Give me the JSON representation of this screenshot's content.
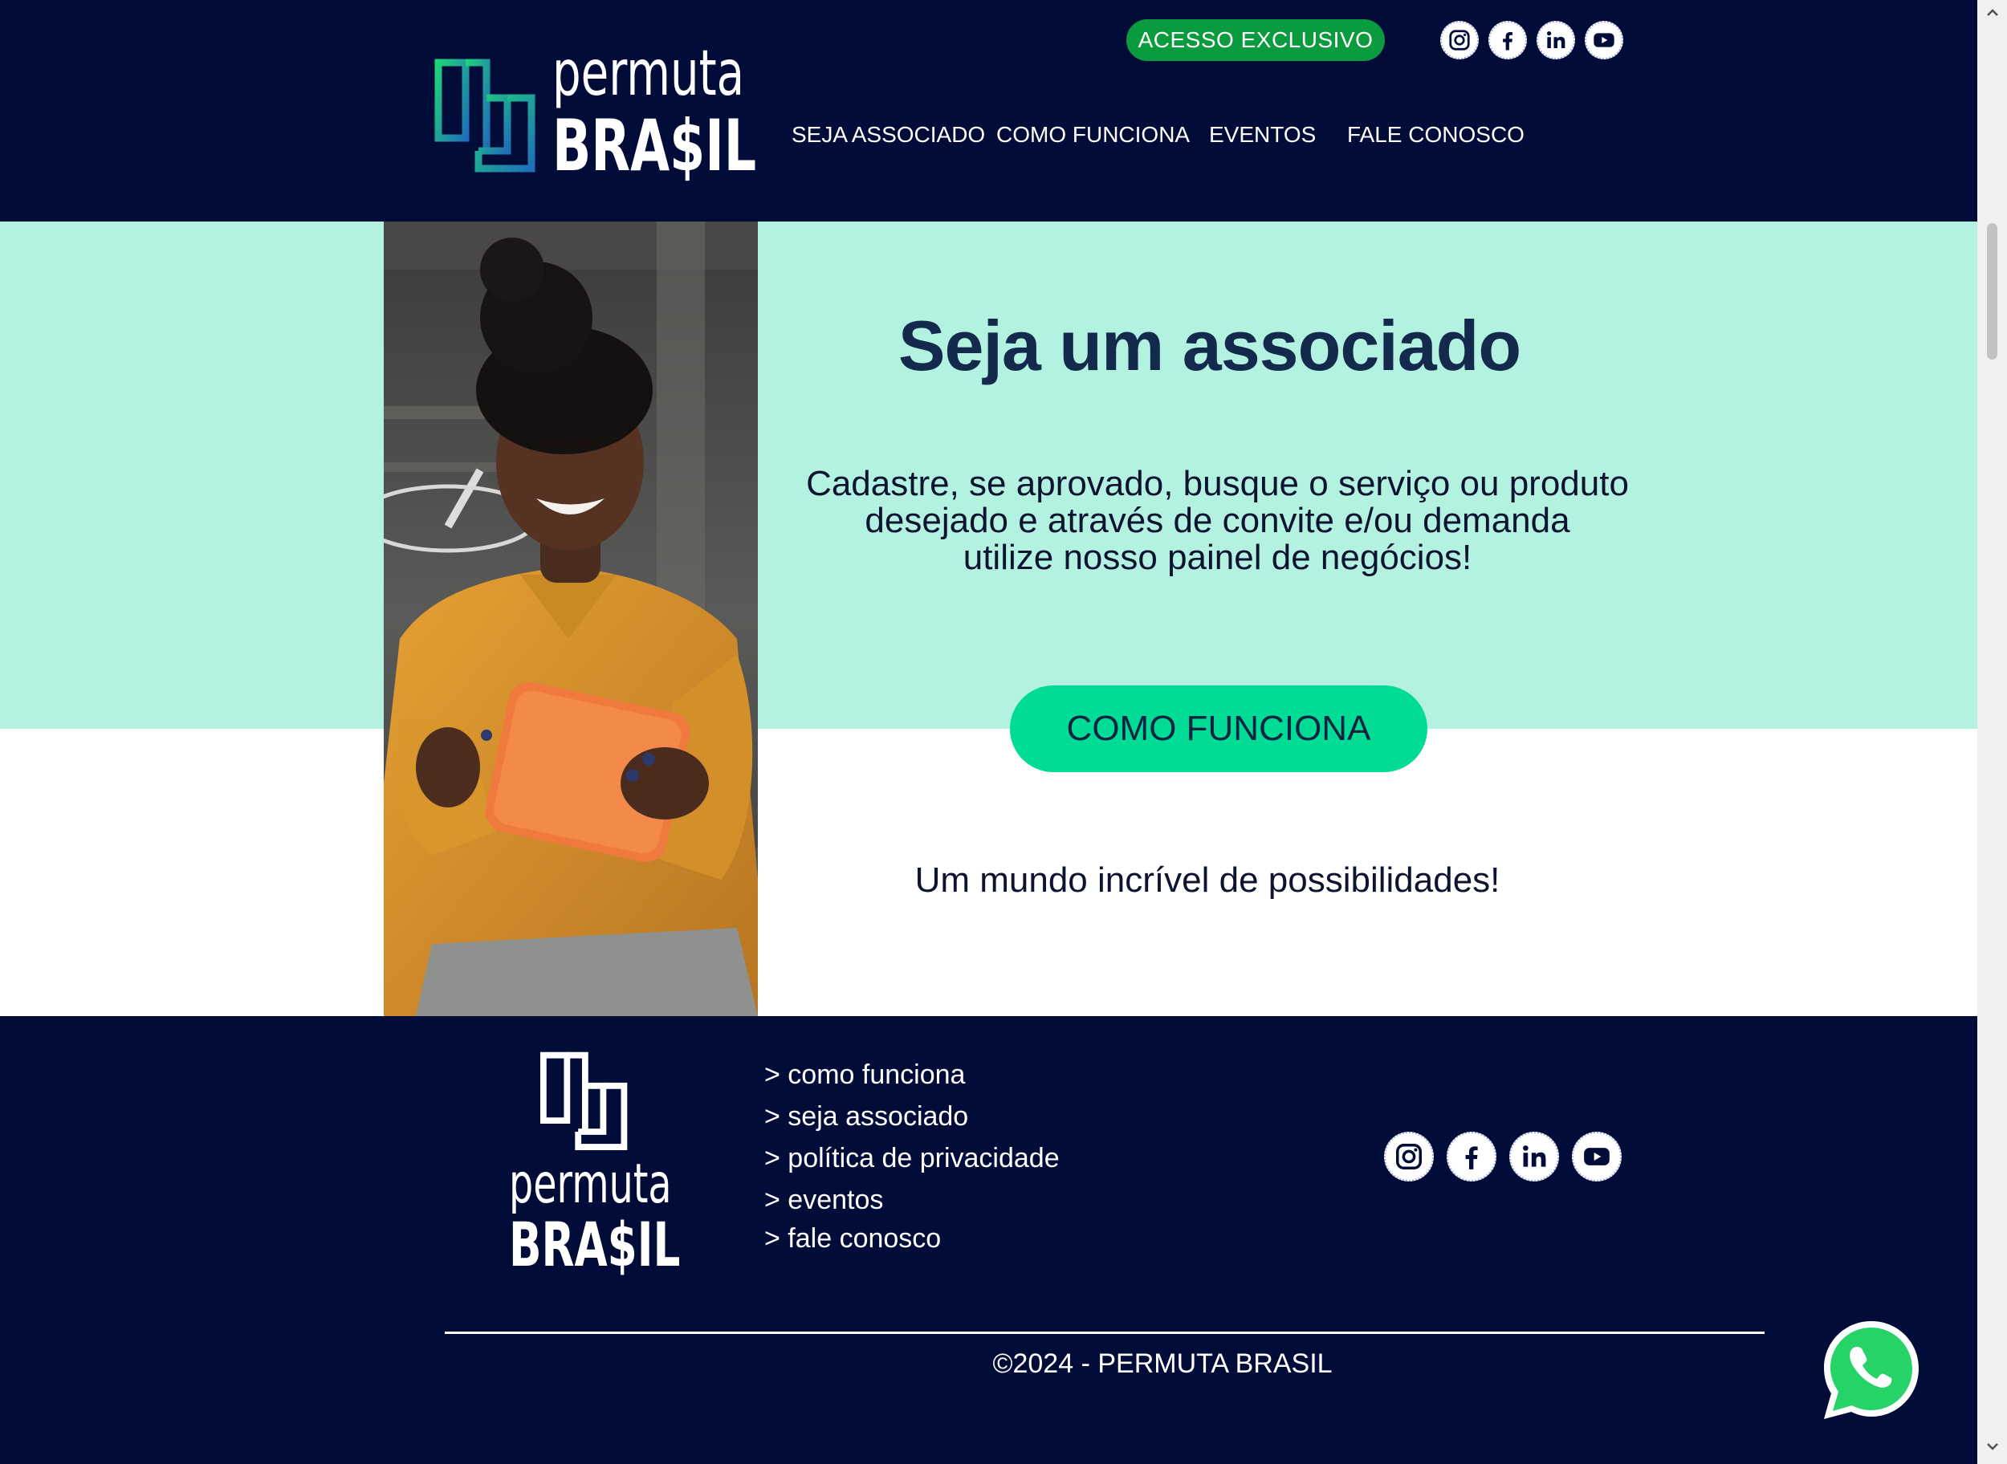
{
  "header": {
    "logo_line1": "permuta",
    "logo_line2": "BRA$IL",
    "exclusive_button": "ACESSO EXCLUSIVO",
    "social_icons": [
      "instagram-icon",
      "facebook-icon",
      "linkedin-icon",
      "youtube-icon"
    ],
    "nav": [
      {
        "label": "SEJA ASSOCIADO"
      },
      {
        "label": "COMO FUNCIONA"
      },
      {
        "label": "EVENTOS"
      },
      {
        "label": "FALE CONOSCO"
      }
    ]
  },
  "hero": {
    "title": "Seja um associado",
    "description_lines": [
      "Cadastre, se aprovado, busque o serviço ou produto",
      "desejado e através de convite e/ou demanda",
      "utilize nosso painel de negócios!"
    ],
    "button": "COMO FUNCIONA",
    "tagline": "Um mundo incrível de possibilidades!"
  },
  "footer": {
    "logo_line1": "permuta",
    "logo_line2": "BRA$IL",
    "links": [
      {
        "label": "> como funciona"
      },
      {
        "label": "> seja associado"
      },
      {
        "label": "> política de privacidade"
      },
      {
        "label": "> eventos"
      },
      {
        "label": "> fale conosco"
      }
    ],
    "social_icons": [
      "instagram-icon",
      "facebook-icon",
      "linkedin-icon",
      "youtube-icon"
    ],
    "copyright": "©2024 - PERMUTA BRASIL"
  },
  "floating": {
    "icon": "whatsapp-icon"
  },
  "colors": {
    "header_bg": "#020c38",
    "hero_bg": "#b3f2e1",
    "accent_green": "#00dc96",
    "exclusive_green": "#0a9b3e",
    "title_navy": "#142a4c"
  }
}
